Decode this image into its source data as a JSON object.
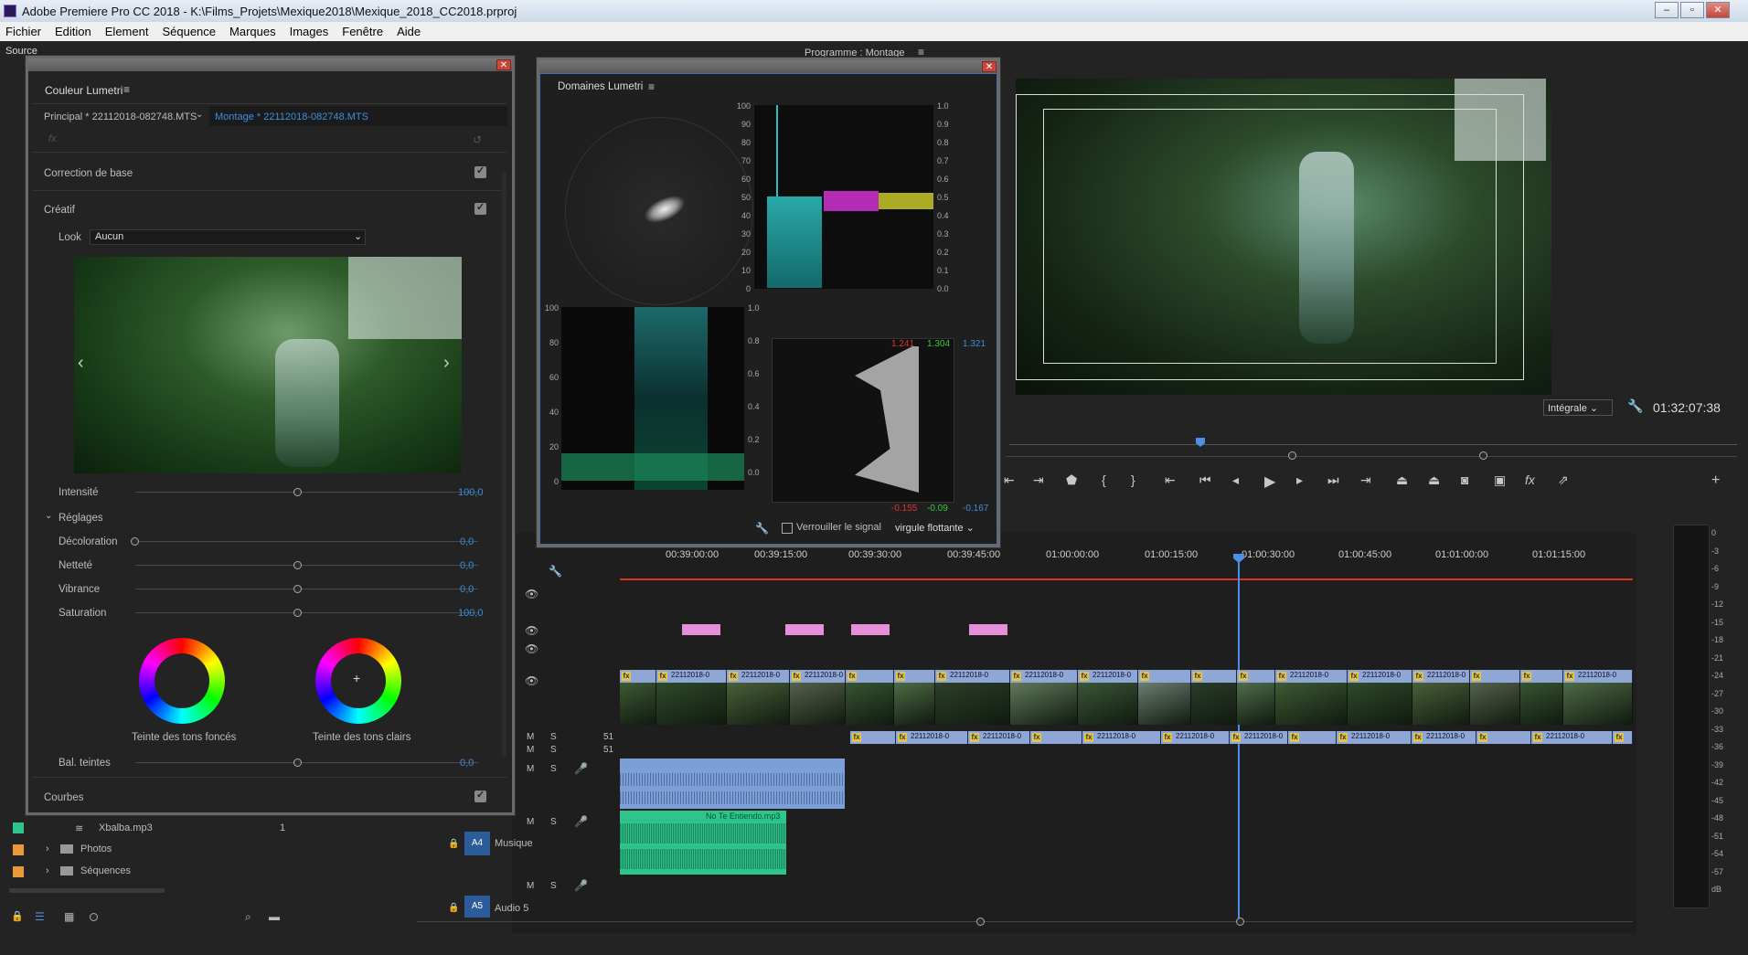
{
  "window": {
    "title": "Adobe Premiere Pro CC 2018 - K:\\Films_Projets\\Mexique2018\\Mexique_2018_CC2018.prproj"
  },
  "menu": [
    "Fichier",
    "Edition",
    "Element",
    "Séquence",
    "Marques",
    "Images",
    "Fenêtre",
    "Aide"
  ],
  "source_tabs": {
    "source": "Source"
  },
  "program": {
    "title": "Programme : Montage",
    "zoom": "Intégrale",
    "timecode": "01:32:07:38"
  },
  "lumetri": {
    "title": "Couleur Lumetri",
    "principal": "Principal * 22112018-082748.MTS",
    "montage": "Montage * 22112018-082748.MTS",
    "fx": "fx",
    "base": "Correction de base",
    "creatif": "Créatif",
    "look_label": "Look",
    "look_value": "Aucun",
    "intensite": "Intensité",
    "intensite_val": "100,0",
    "reglages": "Réglages",
    "sliders": [
      {
        "label": "Décoloration",
        "value": "0,0"
      },
      {
        "label": "Netteté",
        "value": "0,0"
      },
      {
        "label": "Vibrance",
        "value": "0,0"
      },
      {
        "label": "Saturation",
        "value": "100,0"
      }
    ],
    "wheel_dark": "Teinte des tons foncés",
    "wheel_light": "Teinte des tons clairs",
    "bal": "Bal. teintes",
    "bal_val": "0,0",
    "courbes": "Courbes"
  },
  "scopes": {
    "title": "Domaines Lumetri",
    "hist_left": [
      "100",
      "90",
      "80",
      "70",
      "60",
      "50",
      "40",
      "30",
      "20",
      "10",
      "0"
    ],
    "hist_right": [
      "1.0",
      "0.9",
      "0.8",
      "0.7",
      "0.6",
      "0.5",
      "0.4",
      "0.3",
      "0.2",
      "0.1",
      "0.0"
    ],
    "wf_left": [
      "100",
      "80",
      "60",
      "40",
      "20",
      "0"
    ],
    "wf_right": [
      "1.0",
      "0.8",
      "0.6",
      "0.4",
      "0.2",
      "0.0"
    ],
    "rgb_top": [
      "1.241",
      "1.304",
      "1.321"
    ],
    "rgb_bottom": [
      "-0.155",
      "-0.09",
      "-0.167"
    ],
    "lock": "Verrouiller le signal",
    "mode": "virgule flottante"
  },
  "timeline": {
    "ruler": [
      "00:39:00:00",
      "00:39:15:00",
      "00:39:30:00",
      "00:39:45:00",
      "01:00:00:00",
      "01:00:15:00",
      "01:00:30:00",
      "01:00:45:00",
      "01:01:00:00",
      "01:01:15:00"
    ],
    "clip_name": "22112018-0",
    "audio_clip": "No Te Entiendo.mp3",
    "tracks": {
      "a4": "A4",
      "a4_name": "Musique",
      "a5": "A5",
      "a5_name": "Audio 5"
    },
    "m": "M",
    "s": "S",
    "num": "51"
  },
  "project": {
    "items": [
      {
        "name": "Xbalba.mp3",
        "extra": "1"
      },
      {
        "name": "Photos"
      },
      {
        "name": "Séquences"
      }
    ]
  },
  "meter": [
    "0",
    "-3",
    "-6",
    "-9",
    "-12",
    "-15",
    "-18",
    "-21",
    "-24",
    "-27",
    "-30",
    "-33",
    "-36",
    "-39",
    "-42",
    "-45",
    "-48",
    "-51",
    "-54",
    "-57",
    "dB"
  ],
  "colors": {
    "accent": "#3b8fe0",
    "playhead": "#4d8fe6"
  }
}
